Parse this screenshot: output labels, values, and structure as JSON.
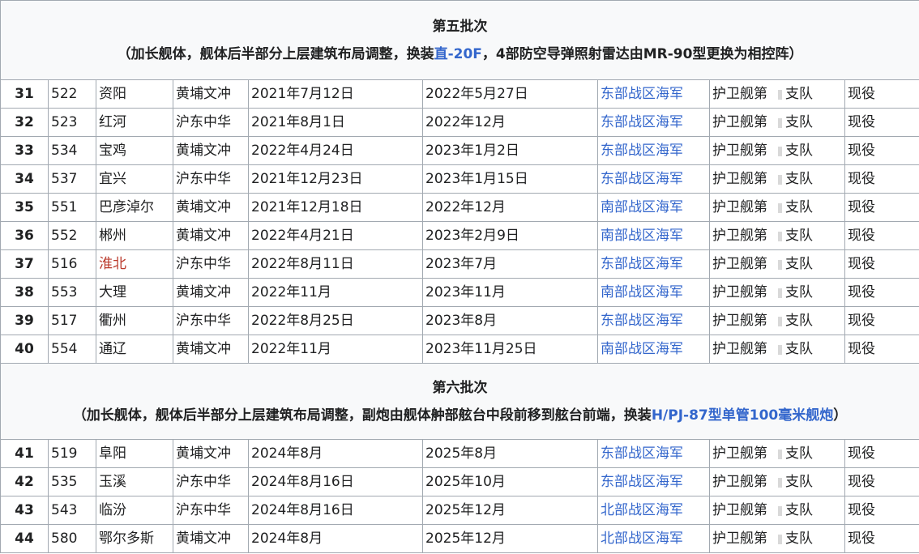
{
  "batch5": {
    "title": "第五批次",
    "note_pre": "（加长舰体，舰体后半部分上层建筑布局调整，换装",
    "note_link": "直-20F",
    "note_post": "，4部防空导弹照射雷达由MR-90型更换为相控阵）",
    "rows": [
      {
        "no": "31",
        "hull": "522",
        "name": "资阳",
        "yard": "黄埔文冲",
        "launch": "2021年7月12日",
        "commission": "2022年5月27日",
        "fleet": "东部战区海军",
        "unit": "护卫舰第支队",
        "status": "现役"
      },
      {
        "no": "32",
        "hull": "523",
        "name": "红河",
        "yard": "沪东中华",
        "launch": "2021年8月1日",
        "commission": "2022年12月",
        "fleet": "东部战区海军",
        "unit": "护卫舰第支队",
        "status": "现役"
      },
      {
        "no": "33",
        "hull": "534",
        "name": "宝鸡",
        "yard": "黄埔文冲",
        "launch": "2022年4月24日",
        "commission": "2023年1月2日",
        "fleet": "东部战区海军",
        "unit": "护卫舰第支队",
        "status": "现役"
      },
      {
        "no": "34",
        "hull": "537",
        "name": "宜兴",
        "yard": "沪东中华",
        "launch": "2021年12月23日",
        "commission": "2023年1月15日",
        "fleet": "东部战区海军",
        "unit": "护卫舰第支队",
        "status": "现役"
      },
      {
        "no": "35",
        "hull": "551",
        "name": "巴彦淖尔",
        "yard": "黄埔文冲",
        "launch": "2021年12月18日",
        "commission": "2022年12月",
        "fleet": "南部战区海军",
        "unit": "护卫舰第支队",
        "status": "现役"
      },
      {
        "no": "36",
        "hull": "552",
        "name": "郴州",
        "yard": "黄埔文冲",
        "launch": "2022年4月21日",
        "commission": "2023年2月9日",
        "fleet": "南部战区海军",
        "unit": "护卫舰第支队",
        "status": "现役"
      },
      {
        "no": "37",
        "hull": "516",
        "name": "淮北",
        "yard": "沪东中华",
        "launch": "2022年8月11日",
        "commission": "2023年7月",
        "fleet": "东部战区海军",
        "unit": "护卫舰第支队",
        "status": "现役"
      },
      {
        "no": "38",
        "hull": "553",
        "name": "大理",
        "yard": "黄埔文冲",
        "launch": "2022年11月",
        "commission": "2023年11月",
        "fleet": "南部战区海军",
        "unit": "护卫舰第支队",
        "status": "现役"
      },
      {
        "no": "39",
        "hull": "517",
        "name": "衢州",
        "yard": "沪东中华",
        "launch": "2022年8月25日",
        "commission": "2023年8月",
        "fleet": "东部战区海军",
        "unit": "护卫舰第支队",
        "status": "现役"
      },
      {
        "no": "40",
        "hull": "554",
        "name": "通辽",
        "yard": "黄埔文冲",
        "launch": "2022年11月",
        "commission": "2023年11月25日",
        "fleet": "南部战区海军",
        "unit": "护卫舰第支队",
        "status": "现役"
      }
    ]
  },
  "batch6": {
    "title": "第六批次",
    "note_pre": "（加长舰体，舰体后半部分上层建筑布局调整，副炮由舰体舯部舷台中段前移到舷台前端，换装",
    "note_link": "H/PJ-87型单管100毫米舰炮",
    "note_post": "）",
    "rows": [
      {
        "no": "41",
        "hull": "519",
        "name": "阜阳",
        "yard": "黄埔文冲",
        "launch": "2024年8月",
        "commission": "2025年8月",
        "fleet": "东部战区海军",
        "unit": "护卫舰第支队",
        "status": "现役"
      },
      {
        "no": "42",
        "hull": "535",
        "name": "玉溪",
        "yard": "沪东中华",
        "launch": "2024年8月16日",
        "commission": "2025年10月",
        "fleet": "东部战区海军",
        "unit": "护卫舰第支队",
        "status": "现役"
      },
      {
        "no": "43",
        "hull": "543",
        "name": "临汾",
        "yard": "沪东中华",
        "launch": "2024年8月16日",
        "commission": "2025年12月",
        "fleet": "北部战区海军",
        "unit": "护卫舰第支队",
        "status": "现役"
      },
      {
        "no": "44",
        "hull": "580",
        "name": "鄂尔多斯",
        "yard": "黄埔文冲",
        "launch": "2024年8月",
        "commission": "2025年12月",
        "fleet": "北部战区海军",
        "unit": "护卫舰第支队",
        "status": "现役"
      }
    ]
  },
  "colors": {
    "link": "#3366cc",
    "redlink": "#ba3a2c",
    "border": "#a2a9b1",
    "header_bg": "#f8f9fa"
  }
}
